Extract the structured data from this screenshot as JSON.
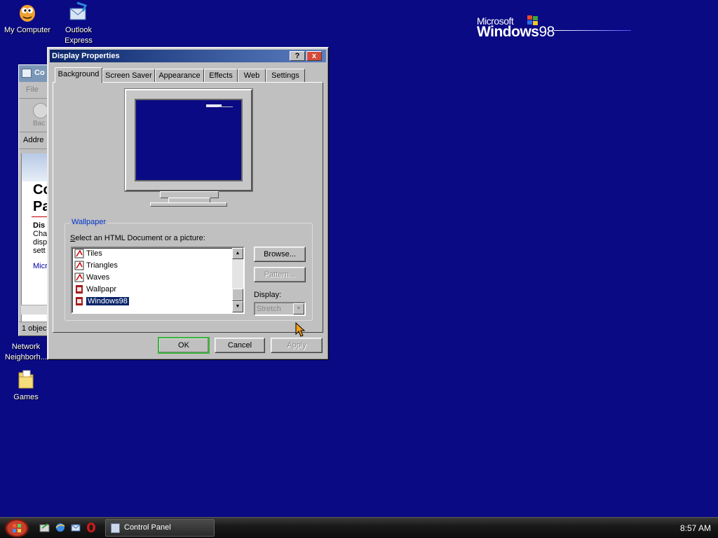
{
  "desktop": {
    "icons": [
      {
        "label": "My Computer"
      },
      {
        "label": "Outlook Express"
      },
      {
        "label": "Network Neighborh..."
      },
      {
        "label": "Games"
      }
    ],
    "logo": {
      "top": "Microsoft",
      "brand": "Windows",
      "version": "98"
    }
  },
  "control_panel_window": {
    "title": "Co",
    "menu": "File",
    "back": "Bac",
    "address": "Addre",
    "heading_line1": "Co",
    "heading_line2": "Pa",
    "section_title": "Dis",
    "desc_lines": [
      "Cha",
      "disp",
      "sett"
    ],
    "link": "Micr",
    "status": "1 objec"
  },
  "dialog": {
    "title": "Display Properties",
    "help_glyph": "?",
    "close_glyph": "x",
    "tabs": [
      {
        "label": "Background",
        "active": true
      },
      {
        "label": "Screen Saver",
        "active": false
      },
      {
        "label": "Appearance",
        "active": false
      },
      {
        "label": "Effects",
        "active": false
      },
      {
        "label": "Web",
        "active": false
      },
      {
        "label": "Settings",
        "active": false
      }
    ],
    "wallpaper": {
      "group_label": "Wallpaper",
      "select_label_prefix": "S",
      "select_label_rest": "elect an HTML Document or a picture:",
      "items": [
        {
          "label": "Tiles",
          "icon": "paint-file-icon"
        },
        {
          "label": "Triangles",
          "icon": "paint-file-icon"
        },
        {
          "label": "Waves",
          "icon": "paint-file-icon"
        },
        {
          "label": "Wallpapr",
          "icon": "html-file-icon"
        },
        {
          "label": "Windows98",
          "icon": "html-file-icon",
          "selected": true
        }
      ],
      "browse_label": "Browse...",
      "pattern_label": "Pattern...",
      "display_label": "Display:",
      "display_value": "Stretch"
    },
    "buttons": {
      "ok": "OK",
      "cancel": "Cancel",
      "apply": "Apply"
    }
  },
  "taskbar": {
    "task_label": "Control Panel",
    "clock": "8:57 AM"
  },
  "colors": {
    "desktop": "#0a0a84",
    "dialog_face": "#c0c0c0",
    "title_active": "#0a246a",
    "selection": "#0a246a",
    "group_label": "#0033cc"
  }
}
